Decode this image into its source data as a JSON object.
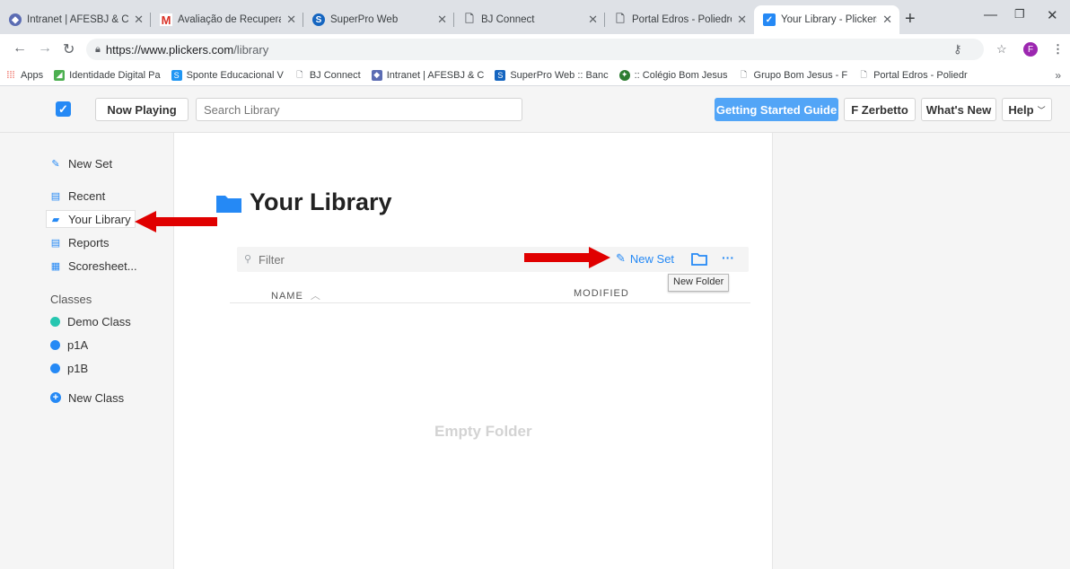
{
  "browser": {
    "tabs": [
      {
        "title": "Intranet | AFESBJ & CN",
        "icon": "intranet-icon",
        "color": "#5b6cb3"
      },
      {
        "title": "Avaliação de Recuperaç",
        "icon": "gmail-icon",
        "color": "#d93025"
      },
      {
        "title": "SuperPro Web",
        "icon": "superpro-icon",
        "color": "#1565c0"
      },
      {
        "title": "BJ Connect",
        "icon": "page-icon",
        "color": "#5f6368"
      },
      {
        "title": "Portal Edros - Poliedro",
        "icon": "page-icon",
        "color": "#5f6368"
      },
      {
        "title": "Your Library - Plickers",
        "icon": "plickers-icon",
        "color": "#2589f5"
      }
    ],
    "url_host": "https://www.plickers.com",
    "url_path": "/library",
    "profile_initial": "F",
    "bookmarks": [
      {
        "label": "Apps",
        "color": "#ea4335"
      },
      {
        "label": "Identidade Digital Pa",
        "color": "#4caf50"
      },
      {
        "label": "Sponte Educacional V",
        "color": "#2196f3"
      },
      {
        "label": "BJ Connect",
        "color": "#9e9e9e"
      },
      {
        "label": "Intranet | AFESBJ & C",
        "color": "#5b6cb3"
      },
      {
        "label": "SuperPro Web :: Banc",
        "color": "#1565c0"
      },
      {
        "label": ":: Colégio Bom Jesus",
        "color": "#2e7d32"
      },
      {
        "label": "Grupo Bom Jesus - F",
        "color": "#9e9e9e"
      },
      {
        "label": "Portal Edros - Poliedr",
        "color": "#9e9e9e"
      }
    ]
  },
  "topbar": {
    "now_playing": "Now Playing",
    "search_placeholder": "Search Library",
    "getting_started": "Getting Started Guide",
    "user": "F Zerbetto",
    "whats_new": "What's New",
    "help": "Help"
  },
  "sidebar": {
    "new_set": "New Set",
    "recent": "Recent",
    "your_library": "Your Library",
    "reports": "Reports",
    "scoresheet": "Scoresheet...",
    "classes_heading": "Classes",
    "classes": [
      {
        "label": "Demo Class",
        "color": "#26c6b0"
      },
      {
        "label": "p1A",
        "color": "#2589f5"
      },
      {
        "label": "p1B",
        "color": "#2589f5"
      }
    ],
    "new_class": "New Class"
  },
  "main": {
    "title": "Your Library",
    "filter_placeholder": "Filter",
    "new_set": "New Set",
    "col_name": "NAME",
    "col_modified": "MODIFIED",
    "empty": "Empty Folder",
    "tooltip": "New Folder"
  },
  "colors": {
    "accent": "#2589f5",
    "annotation_arrow": "#e00000"
  }
}
